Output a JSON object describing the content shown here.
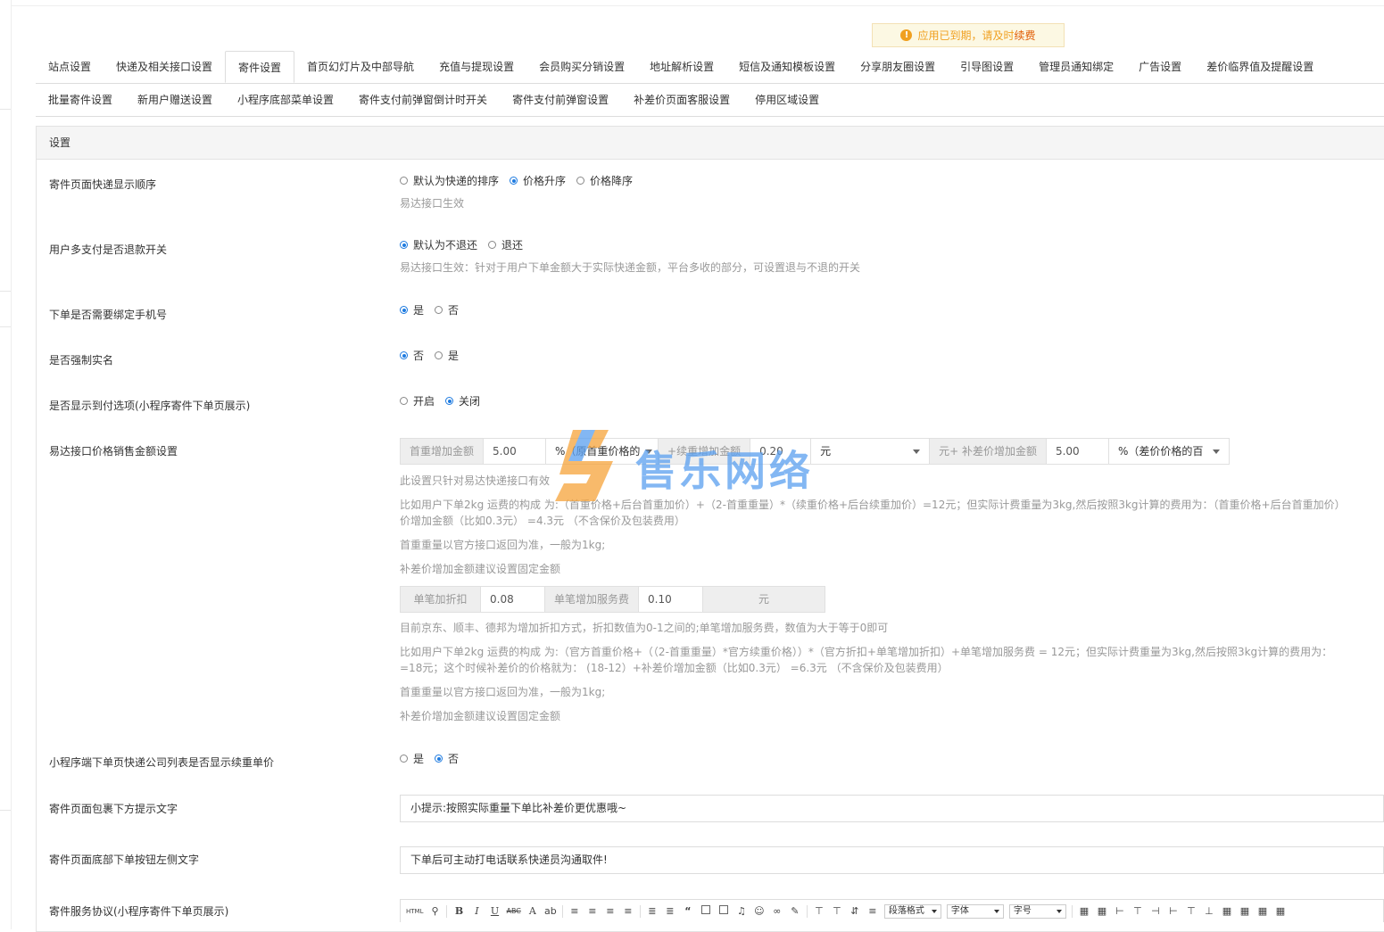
{
  "notice": {
    "text": "应用已到期，请及时",
    "link": "续费"
  },
  "tabs_row1": [
    "站点设置",
    "快递及相关接口设置",
    "寄件设置",
    "首页幻灯片及中部导航",
    "充值与提现设置",
    "会员购买分销设置",
    "地址解析设置",
    "短信及通知模板设置",
    "分享朋友圈设置",
    "引导图设置",
    "管理员通知绑定",
    "广告设置",
    "差价临界值及提醒设置"
  ],
  "tabs_row2": [
    "批量寄件设置",
    "新用户赠送设置",
    "小程序底部菜单设置",
    "寄件支付前弹窗倒计时开关",
    "寄件支付前弹窗设置",
    "补差价页面客服设置",
    "停用区域设置"
  ],
  "active_tab": "寄件设置",
  "panel_title": "设置",
  "settings": {
    "sort_order": {
      "label": "寄件页面快递显示顺序",
      "options": [
        "默认为快递的排序",
        "价格升序",
        "价格降序"
      ],
      "selected": 1,
      "help": "易达接口生效"
    },
    "refund_switch": {
      "label": "用户多支付是否退款开关",
      "options": [
        "默认为不退还",
        "退还"
      ],
      "selected": 0,
      "help": "易达接口生效：针对于用户下单金额大于实际快递金额，平台多收的部分，可设置退与不退的开关"
    },
    "bind_phone": {
      "label": "下单是否需要绑定手机号",
      "options": [
        "是",
        "否"
      ],
      "selected": 0
    },
    "real_name": {
      "label": "是否强制实名",
      "options": [
        "否",
        "是"
      ],
      "selected": 0
    },
    "cod": {
      "label": "是否显示到付选项(小程序寄件下单页展示)",
      "options": [
        "开启",
        "关闭"
      ],
      "selected": 1
    },
    "price_setting": {
      "label": "易达接口价格销售金额设置",
      "first_addon": "首重增加金额",
      "first_value": "5.00",
      "first_unit": "%（原首重价格的",
      "cont_addon": "+续重增加金额",
      "cont_value": "0.20",
      "cont_unit": "元",
      "extra_addon": "元+ 补差价增加金额",
      "extra_value": "5.00",
      "extra_unit": "%（差价价格的百",
      "help1": "此设置只针对易达快递接口有效",
      "help2a": "比如用户下单2kg 运费的构成 为:（首重价格+后台首重加价）+（2-首重重量）*（续重价格+后台续重加价）=12元；但实际计费重量为3kg,然后按照3kg计算的费用为：（首重价格+后台首重加价）",
      "help2b": "价增加金额（比如0.3元） =4.3元 （不含保价及包装费用）",
      "help3": "首重重量以官方接口返回为准，一般为1kg;",
      "help4": "补差价增加金额建议设置固定金额",
      "disc_addon": "单笔加折扣",
      "disc_value": "0.08",
      "fee_addon": "单笔增加服务费",
      "fee_value": "0.10",
      "fee_unit": "元",
      "help5": "目前京东、顺丰、德邦为增加折扣方式，折扣数值为0-1之间的;单笔增加服务费，数值为大于等于0即可",
      "help6a": "比如用户下单2kg 运费的构成 为:（官方首重价格+（（2-首重重量）*官方续重价格））*（官方折扣+单笔增加折扣）+单笔增加服务费 = 12元；但实际计费重量为3kg,然后按照3kg计算的费用为：",
      "help6b": "=18元；这个时候补差价的价格就为： (18-12）+补差价增加金额（比如0.3元） =6.3元 （不含保价及包装费用）",
      "help7": "首重重量以官方接口返回为准，一般为1kg;",
      "help8": "补差价增加金额建议设置固定金额"
    },
    "show_unit_price": {
      "label": "小程序端下单页快递公司列表是否显示续重单价",
      "options": [
        "是",
        "否"
      ],
      "selected": 1
    },
    "package_tip": {
      "label": "寄件页面包裹下方提示文字",
      "value": "小提示:按照实际重量下单比补差价更优惠哦~"
    },
    "bottom_tip": {
      "label": "寄件页面底部下单按钮左侧文字",
      "value": "下单后可主动打电话联系快递员沟通取件!"
    },
    "agreement": {
      "label": "寄件服务协议(小程序寄件下单页展示)",
      "toolbar": {
        "html": "HTML",
        "bold": "B",
        "italic": "I",
        "underline": "U",
        "strike": "ABC",
        "font_color": "A",
        "para": "段落格式",
        "font": "字体",
        "size": "字号"
      }
    }
  },
  "watermark": {
    "text": "售乐网络"
  },
  "colors": {
    "accent": "#1e7be0",
    "warning": "#f0a020"
  }
}
